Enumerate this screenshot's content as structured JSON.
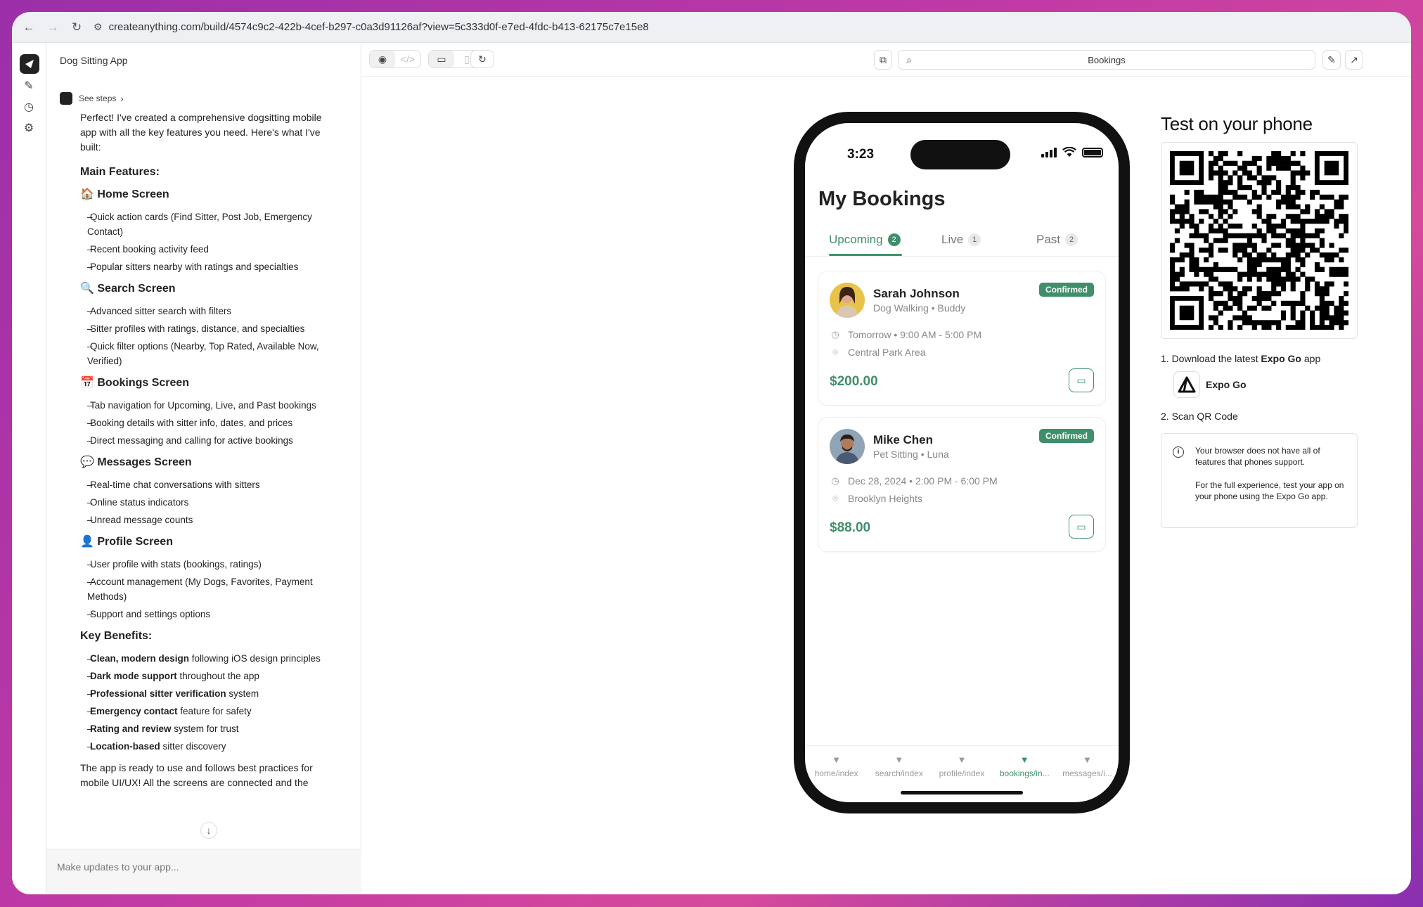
{
  "browser": {
    "url": "createanything.com/build/4574c9c2-422b-4cef-b297-c0a3d91126af?view=5c333d0f-e7ed-4fdc-b413-62175c7e15e8"
  },
  "sidebar": {
    "title": "Dog Sitting App",
    "see_steps": "See steps",
    "scroll_down": "↓",
    "compose_placeholder": "Make updates to your app..."
  },
  "message": {
    "intro": "Perfect! I've created a comprehensive dogsitting mobile app with all the key features you need. Here's what I've built:",
    "main_features": "Main Features:",
    "home_heading": "🏠 Home Screen",
    "home_items": [
      "Quick action cards (Find Sitter, Post Job, Emergency Contact)",
      "Recent booking activity feed",
      "Popular sitters nearby with ratings and specialties"
    ],
    "search_heading": "🔍 Search Screen",
    "search_items": [
      "Advanced sitter search with filters",
      "Sitter profiles with ratings, distance, and specialties",
      "Quick filter options (Nearby, Top Rated, Available Now, Verified)"
    ],
    "bookings_heading": "📅 Bookings Screen",
    "bookings_items": [
      "Tab navigation for Upcoming, Live, and Past bookings",
      "Booking details with sitter info, dates, and prices",
      "Direct messaging and calling for active bookings"
    ],
    "messages_heading": "💬 Messages Screen",
    "messages_items": [
      "Real-time chat conversations with sitters",
      "Online status indicators",
      "Unread message counts"
    ],
    "profile_heading": "👤 Profile Screen",
    "profile_items": [
      "User profile with stats (bookings, ratings)",
      "Account management (My Dogs, Favorites, Payment Methods)",
      "Support and settings options"
    ],
    "benefits_heading": "Key Benefits:",
    "benefits": [
      {
        "bold": "Clean, modern design",
        "rest": " following iOS design principles"
      },
      {
        "bold": "Dark mode support",
        "rest": " throughout the app"
      },
      {
        "bold": "Professional sitter verification",
        "rest": " system"
      },
      {
        "bold": "Emergency contact",
        "rest": " feature for safety"
      },
      {
        "bold": "Rating and review",
        "rest": " system for trust"
      },
      {
        "bold": "Location-based",
        "rest": " sitter discovery"
      }
    ],
    "outro": "The app is ready to use and follows best practices for mobile UI/UX! All the screens are connected and the"
  },
  "toolbar": {
    "search_value": "Bookings"
  },
  "phone": {
    "time": "3:23",
    "title": "My Bookings",
    "tabs": [
      {
        "label": "Upcoming",
        "count": "2"
      },
      {
        "label": "Live",
        "count": "1"
      },
      {
        "label": "Past",
        "count": "2"
      }
    ],
    "bookings": [
      {
        "name": "Sarah Johnson",
        "service": "Dog Walking • Buddy",
        "status": "Confirmed",
        "when": "Tomorrow • 9:00 AM - 5:00 PM",
        "where": "Central Park Area",
        "price": "$200.00"
      },
      {
        "name": "Mike Chen",
        "service": "Pet Sitting • Luna",
        "status": "Confirmed",
        "when": "Dec 28, 2024 • 2:00 PM - 6:00 PM",
        "where": "Brooklyn Heights",
        "price": "$88.00"
      }
    ],
    "tabbar": [
      "home/index",
      "search/index",
      "profile/index",
      "bookings/in...",
      "messages/i..."
    ]
  },
  "qr_panel": {
    "title": "Test on your phone",
    "step1_prefix": "1. Download the latest ",
    "step1_bold": "Expo Go",
    "step1_suffix": " app",
    "expo_name": "Expo Go",
    "step2": "2. Scan QR Code",
    "notice_1": "Your browser does not have all of features that phones support.",
    "notice_2": "For the full experience, test your app on your phone using the Expo Go app."
  },
  "colors": {
    "accent": "#3f8f6b",
    "annotation_arrow": "#e8232b"
  }
}
